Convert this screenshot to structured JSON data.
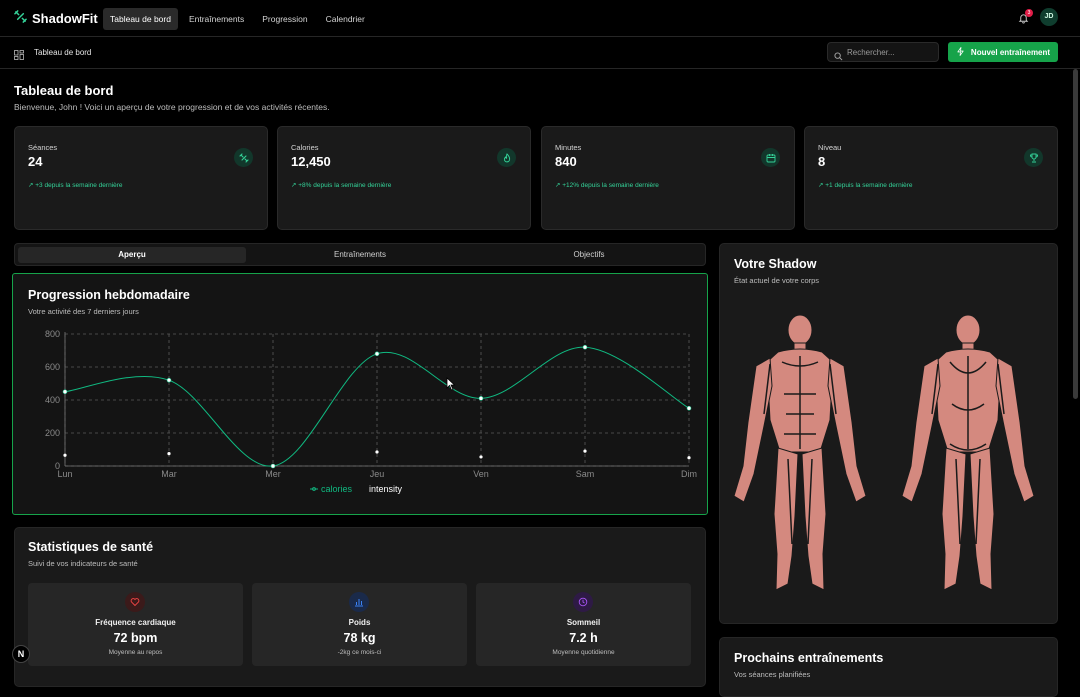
{
  "app": {
    "name": "ShadowFit",
    "user_initials": "JD",
    "notification_count": "3"
  },
  "nav": {
    "items": [
      {
        "label": "Tableau de bord",
        "active": true
      },
      {
        "label": "Entraînements",
        "active": false
      },
      {
        "label": "Progression",
        "active": false
      },
      {
        "label": "Calendrier",
        "active": false
      }
    ]
  },
  "subbar": {
    "title": "Tableau de bord",
    "search_placeholder": "Rechercher...",
    "new_workout_label": "Nouvel entraînement"
  },
  "header": {
    "title": "Tableau de bord",
    "subtitle": "Bienvenue, John ! Voici un aperçu de votre progression et de vos activités récentes."
  },
  "stats": [
    {
      "label": "Séances",
      "value": "24",
      "change": "+3 depuis la semaine dernière",
      "icon": "dumbbell-icon"
    },
    {
      "label": "Calories",
      "value": "12,450",
      "change": "+8% depuis la semaine dernière",
      "icon": "flame-icon"
    },
    {
      "label": "Minutes",
      "value": "840",
      "change": "+12% depuis la semaine dernière",
      "icon": "calendar-icon"
    },
    {
      "label": "Niveau",
      "value": "8",
      "change": "+1 depuis la semaine dernière",
      "icon": "trophy-icon"
    }
  ],
  "tabs": [
    {
      "label": "Aperçu",
      "active": true
    },
    {
      "label": "Entraînements",
      "active": false
    },
    {
      "label": "Objectifs",
      "active": false
    }
  ],
  "weekly": {
    "title": "Progression hebdomadaire",
    "subtitle": "Votre activité des 7 derniers jours"
  },
  "chart_data": {
    "type": "line",
    "categories": [
      "Lun",
      "Mar",
      "Mer",
      "Jeu",
      "Ven",
      "Sam",
      "Dim"
    ],
    "series": [
      {
        "name": "calories",
        "values": [
          450,
          520,
          0,
          680,
          410,
          720,
          350
        ],
        "color": "#10b981"
      },
      {
        "name": "intensity",
        "values": [
          65,
          75,
          0,
          85,
          55,
          90,
          50
        ],
        "color": "#ffffff"
      }
    ],
    "yticks": [
      0,
      200,
      400,
      600,
      800
    ],
    "ylim": [
      0,
      800
    ],
    "grid": true,
    "legend": "bottom"
  },
  "health": {
    "title": "Statistiques de santé",
    "subtitle": "Suivi de vos indicateurs de santé",
    "metrics": [
      {
        "label": "Fréquence cardiaque",
        "value": "72 bpm",
        "sub": "Moyenne au repos",
        "icon": "heart-icon",
        "color": "#ef4444"
      },
      {
        "label": "Poids",
        "value": "78 kg",
        "sub": "-2kg ce mois-ci",
        "icon": "bar-chart-icon",
        "color": "#3b82f6"
      },
      {
        "label": "Sommeil",
        "value": "7.2 h",
        "sub": "Moyenne quotidienne",
        "icon": "clock-icon",
        "color": "#a855f7"
      }
    ]
  },
  "shadow": {
    "title": "Votre Shadow",
    "subtitle": "État actuel de votre corps",
    "body_color": "#d4897f"
  },
  "upcoming": {
    "title": "Prochains entraînements",
    "subtitle": "Vos séances planifiées"
  },
  "floating": {
    "badge_label": "N"
  }
}
